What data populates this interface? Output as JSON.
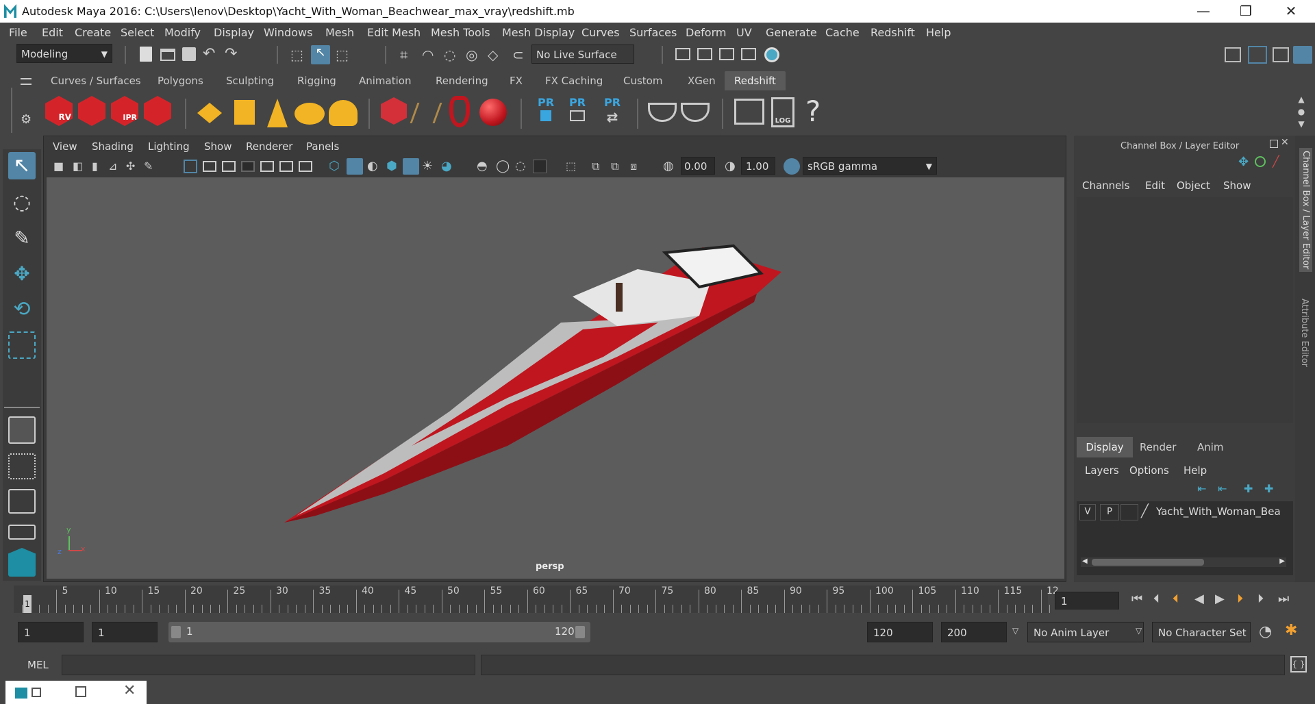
{
  "window": {
    "title": "Autodesk Maya 2016: C:\\Users\\lenov\\Desktop\\Yacht_With_Woman_Beachwear_max_vray\\redshift.mb",
    "min": "—",
    "max": "❐",
    "close": "✕"
  },
  "menus": [
    "File",
    "Edit",
    "Create",
    "Select",
    "Modify",
    "Display",
    "Windows",
    "Mesh",
    "Edit Mesh",
    "Mesh Tools",
    "Mesh Display",
    "Curves",
    "Surfaces",
    "Deform",
    "UV",
    "Generate",
    "Cache",
    "Redshift",
    "Help"
  ],
  "status": {
    "mode": "Modeling",
    "live_surface": "No Live Surface"
  },
  "shelf_tabs": [
    "Curves / Surfaces",
    "Polygons",
    "Sculpting",
    "Rigging",
    "Animation",
    "Rendering",
    "FX",
    "FX Caching",
    "Custom",
    "XGen",
    "Redshift"
  ],
  "shelf_active": "Redshift",
  "shelf_icons": {
    "rv": "RV",
    "ipr": "IPR",
    "pr1": "PR",
    "pr2": "PR",
    "pr3": "PR",
    "log": "LOG",
    "help": "?"
  },
  "viewport": {
    "menus": [
      "View",
      "Shading",
      "Lighting",
      "Show",
      "Renderer",
      "Panels"
    ],
    "exposure": "0.00",
    "gamma": "1.00",
    "colorspace": "sRGB gamma",
    "camera": "persp",
    "axis_x": "x",
    "axis_y": "y",
    "axis_z": "z"
  },
  "channel_box": {
    "title": "Channel Box / Layer Editor",
    "menus": [
      "Channels",
      "Edit",
      "Object",
      "Show"
    ],
    "tabs": [
      "Display",
      "Render",
      "Anim"
    ],
    "active_tab": "Display",
    "layer_menus": [
      "Layers",
      "Options",
      "Help"
    ],
    "layer": {
      "v": "V",
      "p": "P",
      "name": "Yacht_With_Woman_Bea"
    }
  },
  "side_tabs": [
    "Channel Box / Layer Editor",
    "Attribute Editor"
  ],
  "timeline": {
    "ticks": [
      "5",
      "10",
      "15",
      "20",
      "25",
      "30",
      "35",
      "40",
      "45",
      "50",
      "55",
      "60",
      "65",
      "70",
      "75",
      "80",
      "85",
      "90",
      "95",
      "100",
      "105",
      "110",
      "115",
      "12"
    ],
    "start_marker": "1",
    "current_frame": "1"
  },
  "range": {
    "start": "1",
    "start2": "1",
    "slider_start": "1",
    "slider_end": "120",
    "end": "120",
    "end2": "200",
    "anim_layer": "No Anim Layer",
    "char_set": "No Character Set"
  },
  "mel": {
    "label": "MEL"
  },
  "colors": {
    "accent": "#5285a6",
    "hull": "#c0161f",
    "bg": "#444444"
  }
}
